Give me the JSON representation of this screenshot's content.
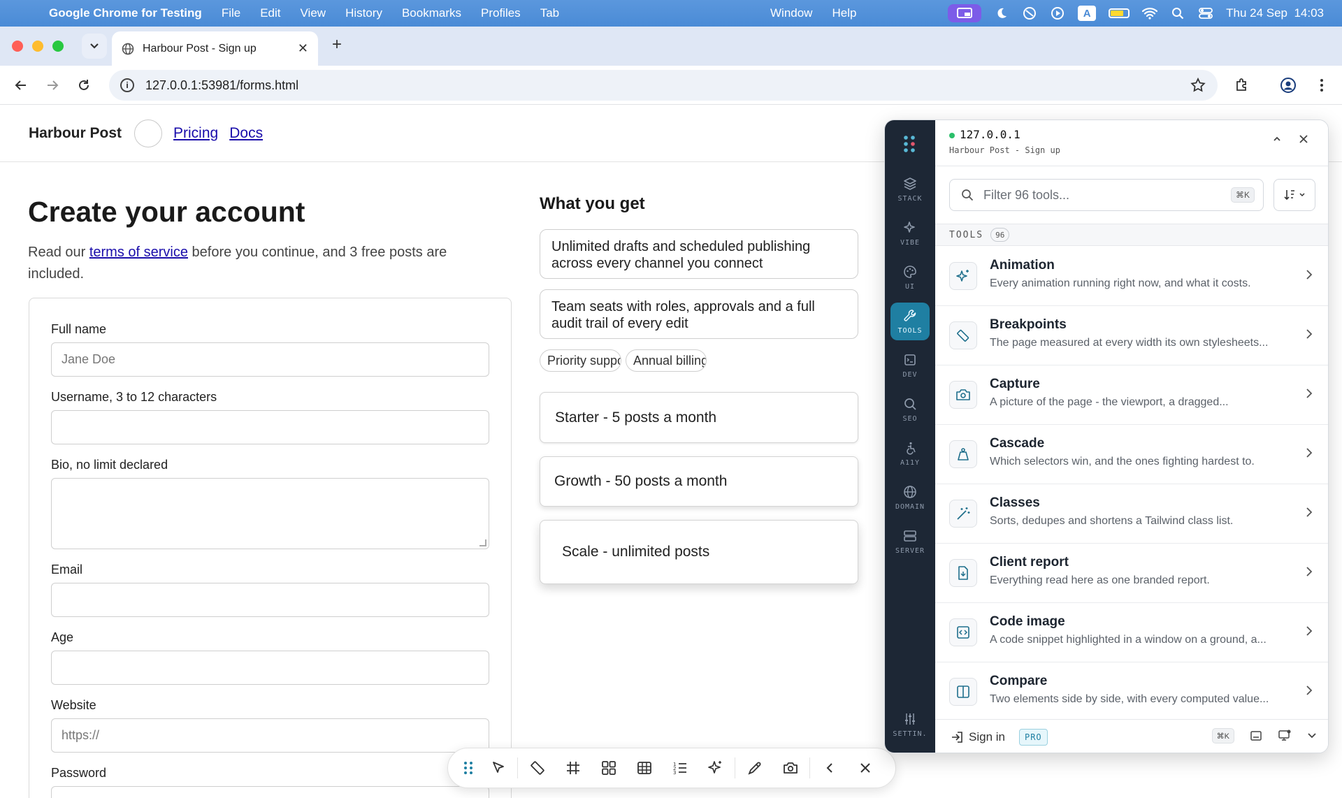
{
  "menubar": {
    "app": "Google Chrome for Testing",
    "items": [
      "File",
      "Edit",
      "View",
      "History",
      "Bookmarks",
      "Profiles",
      "Tab"
    ],
    "center_items": [
      "Window",
      "Help"
    ],
    "clock": "Thu 24 Sep  14:03",
    "input_source": "A"
  },
  "browser": {
    "tab_title": "Harbour Post - Sign up",
    "url": "127.0.0.1:53981/forms.html"
  },
  "site": {
    "brand": "Harbour Post",
    "nav": [
      "Pricing",
      "Docs"
    ]
  },
  "signup": {
    "title": "Create your account",
    "lead_before": "Read our ",
    "lead_link": "terms of service",
    "lead_after": " before you continue, and 3 free posts are included.",
    "fields": {
      "full_name": {
        "label": "Full name",
        "placeholder": "Jane Doe"
      },
      "username": {
        "label": "Username, 3 to 12 characters"
      },
      "bio": {
        "label": "Bio, no limit declared"
      },
      "email": {
        "label": "Email"
      },
      "age": {
        "label": "Age"
      },
      "website": {
        "label": "Website",
        "placeholder": "https://"
      },
      "password": {
        "label": "Password"
      }
    }
  },
  "benefits": {
    "title": "What you get",
    "items": [
      "Unlimited drafts and scheduled publishing across every channel you connect",
      "Team seats with roles, approvals and a full audit trail of every edit"
    ],
    "chips": [
      "Priority support",
      "Annual billing"
    ],
    "plans": [
      "Starter - 5 posts a month",
      "Growth - 50 posts a month",
      "Scale - unlimited posts"
    ]
  },
  "panel": {
    "host": "127.0.0.1",
    "page": "Harbour Post - Sign up",
    "search_placeholder": "Filter 96 tools...",
    "search_kbd": "⌘K",
    "section": "TOOLS",
    "section_count": "96",
    "rail": [
      {
        "label": "STACK",
        "icon": "layers-icon"
      },
      {
        "label": "VIBE",
        "icon": "sparkle-icon"
      },
      {
        "label": "UI",
        "icon": "palette-icon"
      },
      {
        "label": "TOOLS",
        "icon": "wrench-icon",
        "active": true
      },
      {
        "label": "DEV",
        "icon": "terminal-icon"
      },
      {
        "label": "SEO",
        "icon": "search-icon"
      },
      {
        "label": "A11Y",
        "icon": "accessibility-icon"
      },
      {
        "label": "DOMAIN",
        "icon": "globe-icon"
      },
      {
        "label": "SERVER",
        "icon": "server-icon"
      }
    ],
    "settings_label": "SETTIN.",
    "tools": [
      {
        "name": "Animation",
        "desc": "Every animation running right now, and what it costs.",
        "icon": "sparkles-icon"
      },
      {
        "name": "Breakpoints",
        "desc": "The page measured at every width its own stylesheets...",
        "icon": "ruler-icon"
      },
      {
        "name": "Capture",
        "desc": "A picture of the page - the viewport, a dragged...",
        "icon": "camera-icon"
      },
      {
        "name": "Cascade",
        "desc": "Which selectors win, and the ones fighting hardest to.",
        "icon": "weight-icon"
      },
      {
        "name": "Classes",
        "desc": "Sorts, dedupes and shortens a Tailwind class list.",
        "icon": "magic-wand-icon"
      },
      {
        "name": "Client report",
        "desc": "Everything read here as one branded report.",
        "icon": "report-icon"
      },
      {
        "name": "Code image",
        "desc": "A code snippet highlighted in a window on a ground, a...",
        "icon": "code-icon"
      },
      {
        "name": "Compare",
        "desc": "Two elements side by side, with every computed value...",
        "icon": "columns-icon"
      }
    ],
    "sign_in": "Sign in",
    "pro": "PRO",
    "footer_kbd": "⌘K"
  }
}
